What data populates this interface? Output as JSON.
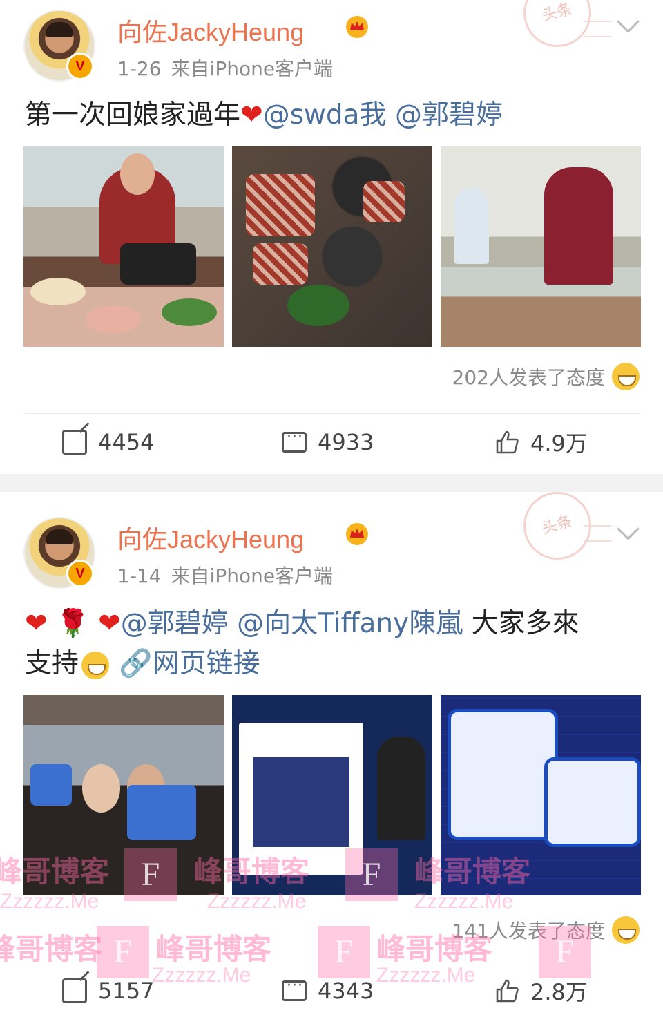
{
  "posts": [
    {
      "username": "向佐JackyHeung",
      "date": "1-26",
      "source": "来自iPhone客户端",
      "verified_badge": "V",
      "text_prefix": "第一次回娘家過年",
      "mentions": [
        "@swda我",
        "@郭碧婷"
      ],
      "reactions_text": "202人发表了态度",
      "reposts": "4454",
      "comments": "4933",
      "likes": "4.9万"
    },
    {
      "username": "向佐JackyHeung",
      "date": "1-14",
      "source": "来自iPhone客户端",
      "verified_badge": "V",
      "mentions": [
        "@郭碧婷",
        "@向太Tiffany陳嵐"
      ],
      "text_mid": "大家多來",
      "text_line2": "支持",
      "link_text": "网页链接",
      "reactions_text": "141人发表了态度",
      "reposts": "5157",
      "comments": "4343",
      "likes": "2.8万"
    }
  ],
  "stamp_text": "头条",
  "watermarks": {
    "title": "峰哥博客",
    "domain": "Zzzzzz.Me",
    "logo_letter": "F"
  },
  "colors": {
    "username": "#eb7350",
    "mention": "#4a6e9b",
    "heart": "#e0221f",
    "separator": "#f2f2f2"
  },
  "icons": [
    "crown-icon",
    "chevron-down-icon",
    "repost-icon",
    "comment-icon",
    "like-icon",
    "grin-emoji-icon",
    "link-icon",
    "heart-icon",
    "rose-icon"
  ]
}
